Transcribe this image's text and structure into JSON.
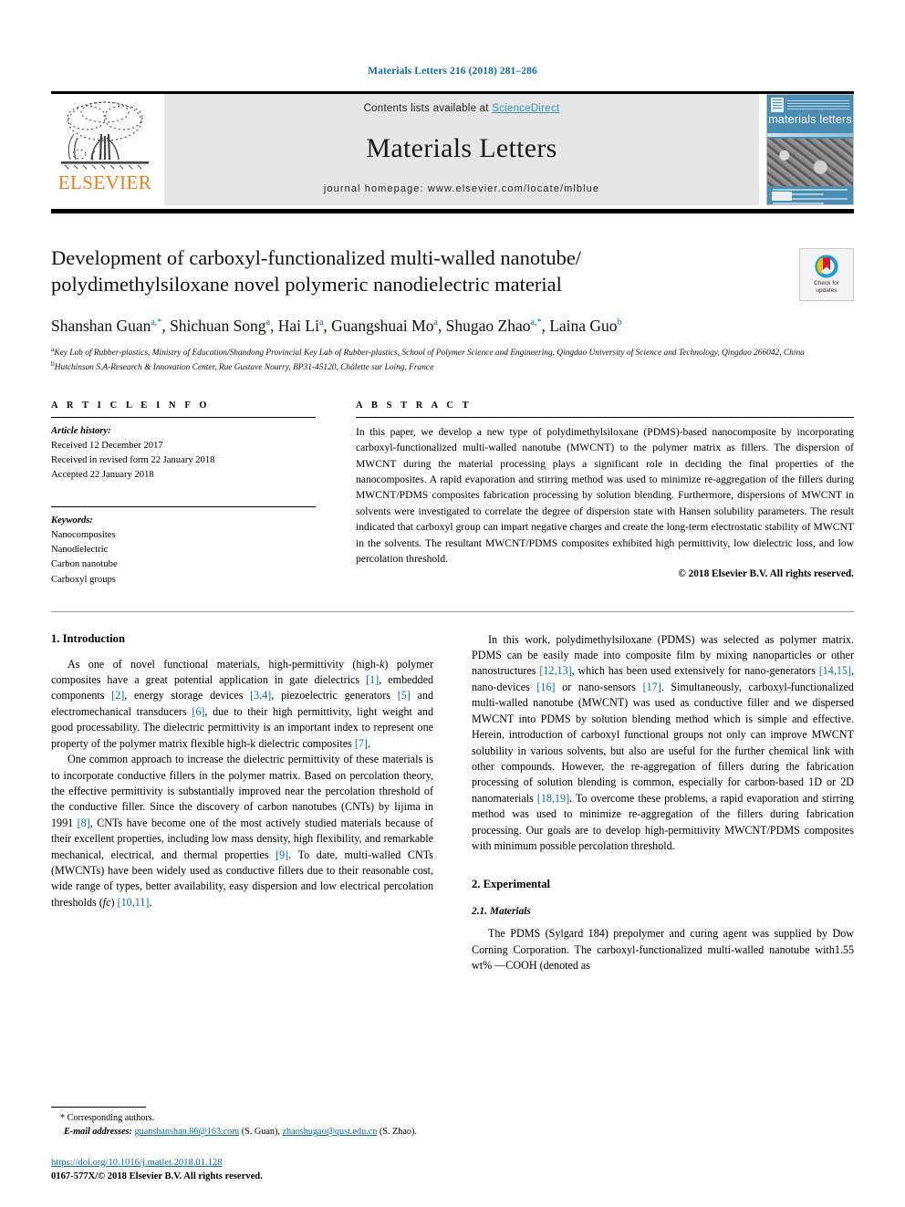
{
  "running_head": "Materials Letters 216 (2018) 281–286",
  "masthead": {
    "publisher_name": "ELSEVIER",
    "contents_prefix": "Contents lists available at ",
    "contents_link": "ScienceDirect",
    "journal_name": "Materials Letters",
    "homepage": "journal homepage: www.elsevier.com/locate/mlblue",
    "cover_title": "materials letters"
  },
  "article": {
    "title_line1": "Development of carboxyl-functionalized multi-walled nanotube/",
    "title_line2": "polydimethylsiloxane novel polymeric nanodielectric material",
    "crossmark_line1": "Check for",
    "crossmark_line2": "updates",
    "authors": "Shanshan Guan a,*, Shichuan Song a, Hai Li a, Guangshuai Mo a, Shugao Zhao a,*, Laina Guo b",
    "authors_parts": [
      {
        "name": "Shanshan Guan",
        "sup": "a,*",
        "sep": ", "
      },
      {
        "name": "Shichuan Song",
        "sup": "a",
        "sep": ", "
      },
      {
        "name": "Hai Li",
        "sup": "a",
        "sep": ", "
      },
      {
        "name": "Guangshuai Mo",
        "sup": "a",
        "sep": ", "
      },
      {
        "name": "Shugao Zhao",
        "sup": "a,*",
        "sep": ", "
      },
      {
        "name": "Laina Guo",
        "sup": "b",
        "sep": ""
      }
    ],
    "affiliation_a_sup": "a",
    "affiliation_a": "Key Lab of Rubber-plastics, Ministry of Education/Shandong Provincial Key Lab of Rubber-plastics, School of Polymer Science and Engineering, Qingdao University of Science and Technology, Qingdao 266042, China",
    "affiliation_b_sup": "b",
    "affiliation_b": "Hutchinson S.A-Research & Innovation Center, Rue Gustave Nourry, BP31-45120, Châlette sur Loing, France"
  },
  "article_info": {
    "heading": "A R T I C L E   I N F O",
    "history_label": "Article history:",
    "history": [
      "Received 12 December 2017",
      "Received in revised form 22 January 2018",
      "Accepted 22 January 2018"
    ],
    "keywords_label": "Keywords:",
    "keywords": [
      "Nanocomposites",
      "Nanodielectric",
      "Carbon nanotube",
      "Carboxyl groups"
    ]
  },
  "abstract": {
    "heading": "A B S T R A C T",
    "text": "In this paper, we develop a new type of polydimethylsiloxane (PDMS)-based nanocomposite by incorporating carboxyl-functionalized multi-walled nanotube (MWCNT) to the polymer matrix as fillers. The dispersion of MWCNT during the material processing plays a significant role in deciding the final properties of the nanocomposites. A rapid evaporation and stirring method was used to minimize re-aggregation of the fillers during MWCNT/PDMS composites fabrication processing by solution blending. Furthermore, dispersions of MWCNT in solvents were investigated to correlate the degree of dispersion state with Hansen solubility parameters. The result indicated that carboxyl group can impart negative charges and create the long-term electrostatic stability of MWCNT in the solvents. The resultant MWCNT/PDMS composites exhibited high permittivity, low dielectric loss, and low percolation threshold.",
    "copyright": "© 2018 Elsevier B.V. All rights reserved."
  },
  "sections": {
    "intro_heading": "1. Introduction",
    "intro_p1_a": "As one of novel functional materials, high-permittivity (high-",
    "intro_p1_k": "k",
    "intro_p1_b": ") polymer composites have a great potential application in gate dielectrics ",
    "intro_p1_r1": "[1]",
    "intro_p1_c": ", embedded components ",
    "intro_p1_r2": "[2]",
    "intro_p1_d": ", energy storage devices ",
    "intro_p1_r3": "[3,4]",
    "intro_p1_e": ", piezoelectric generators ",
    "intro_p1_r4": "[5]",
    "intro_p1_f": " and electromechanical transducers ",
    "intro_p1_r5": "[6]",
    "intro_p1_g": ", due to their high permittivity, light weight and good processability. The dielectric permittivity is an important index to represent one property of the polymer matrix flexible high-k dielectric composites ",
    "intro_p1_r6": "[7]",
    "intro_p1_h": ".",
    "intro_p2_a": "One common approach to increase the dielectric permittivity of these materials is to incorporate conductive fillers in the polymer matrix. Based on percolation theory, the effective permittivity is substantially improved near the percolation threshold of the conductive filler. Since the discovery of carbon nanotubes (CNTs) by Iijima in 1991 ",
    "intro_p2_r1": "[8]",
    "intro_p2_b": ", CNTs have become one of the most actively studied materials because of their excellent properties, including low mass density, high flexibility, and remarkable mechanical, electrical, and thermal properties ",
    "intro_p2_r2": "[9]",
    "intro_p2_c": ". To date, multi-walled CNTs (MWCNTs) have been widely used as conductive fillers due to their reasonable cost, wide range of types, better availability, easy dispersion and low electrical percolation thresholds (",
    "intro_p2_fc": "fc",
    "intro_p2_d": ") ",
    "intro_p2_r3": "[10,11]",
    "intro_p2_e": ".",
    "intro_p3_a": "In this work, polydimethylsiloxane (PDMS) was selected as polymer matrix. PDMS can be easily made into composite film by mixing nanoparticles or other nanostructures ",
    "intro_p3_r1": "[12,13]",
    "intro_p3_b": ", which has been used extensively for nano-generators ",
    "intro_p3_r2": "[14,15]",
    "intro_p3_c": ", nano-devices ",
    "intro_p3_r3": "[16]",
    "intro_p3_d": " or nano-sensors ",
    "intro_p3_r4": "[17]",
    "intro_p3_e": ". Simultaneously, carboxyl-functionalized multi-walled nanotube (MWCNT) was used as conductive filler and we dispersed MWCNT into PDMS by solution blending method which is simple and effective. Herein, introduction of carboxyl functional groups not only can improve MWCNT solubility in various solvents, but also are useful for the further chemical link with other compounds. However, the re-aggregation of fillers during the fabrication processing of solution blending is common, especially for carbon-based 1D or 2D nanomaterials ",
    "intro_p3_r5": "[18,19]",
    "intro_p3_f": ". To overcome these problems, a rapid evaporation and stirring method was used to minimize re-aggregation of the fillers during fabrication processing. Our goals are to develop high-permittivity MWCNT/PDMS composites with minimum possible percolation threshold.",
    "exp_heading": "2. Experimental",
    "materials_heading": "2.1. Materials",
    "materials_p1": "The PDMS (Sylgard 184) prepolymer and curing agent was supplied by Dow Corning Corporation. The carboxyl-functionalized multi-walled nanotube with1.55 wt% —COOH (denoted as"
  },
  "footnote": {
    "star": "*",
    "corresponding": "Corresponding authors.",
    "email_label": "E-mail addresses:",
    "email1": "guanshanshan.86@163.com",
    "email1_who": " (S. Guan), ",
    "email2": "zhaoshugao@qust.edu.cn",
    "email2_who": " (S. Zhao).",
    "doi": "https://doi.org/10.1016/j.matlet.2018.01.128",
    "issn": "0167-577X/© 2018 Elsevier B.V. All rights reserved."
  },
  "colors": {
    "link": "#0b6ca8",
    "sciencedirect": "#3a8fbf",
    "elsevier_orange": "#f07c1a",
    "band_bg": "#e6e6e6",
    "cover_blue": "#4b8cb3"
  }
}
